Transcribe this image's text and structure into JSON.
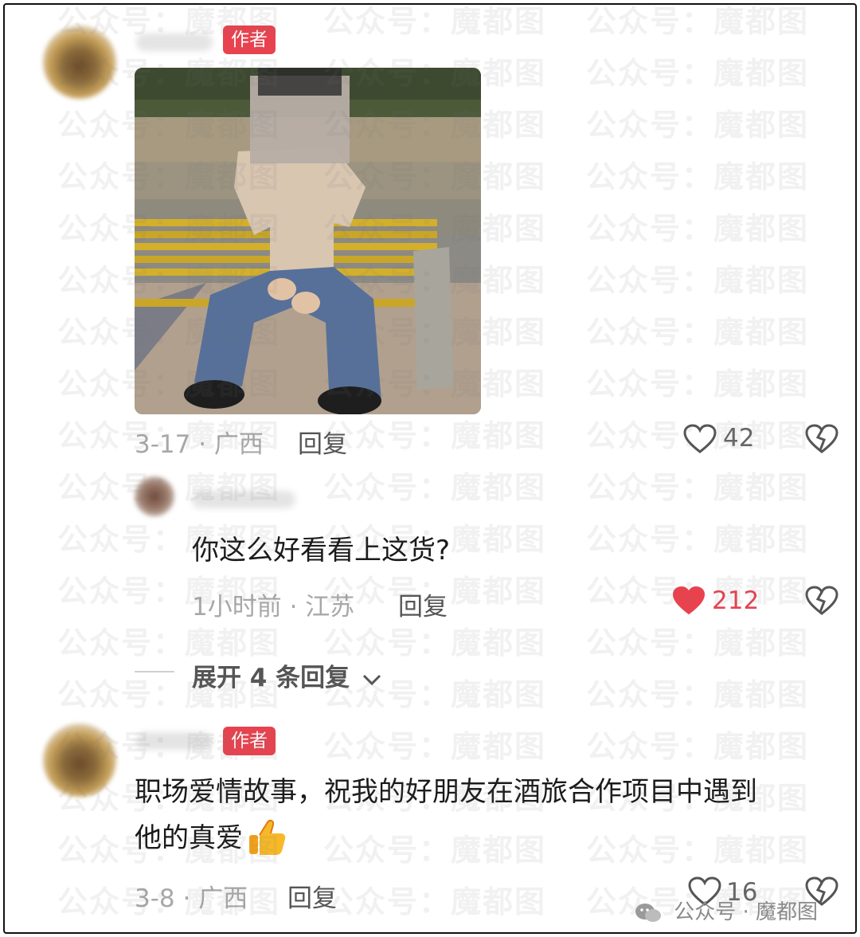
{
  "watermark_text": "公众号：魔都图",
  "comments": [
    {
      "author_badge": "作者",
      "date_location": "3-17 · 广西",
      "reply_label": "回复",
      "likes": "42",
      "liked": false
    },
    {
      "text": "你这么好看看上这货?",
      "date_location": "1小时前 · 江苏",
      "reply_label": "回复",
      "likes": "212",
      "liked": true,
      "expand_label": "展开 4 条回复"
    },
    {
      "author_badge": "作者",
      "text_line1": "职场爱情故事，祝我的好朋友在酒旅合作项目中遇到",
      "text_line2": "他的真爱",
      "emoji": "thumbs-up",
      "date_location": "3-8 · 广西",
      "reply_label": "回复",
      "likes": "16",
      "liked": false
    }
  ],
  "footer": {
    "brand": "公众号 · 魔都图"
  },
  "colors": {
    "accent_red": "#e8424f",
    "meta_gray": "#a8a8a8"
  }
}
